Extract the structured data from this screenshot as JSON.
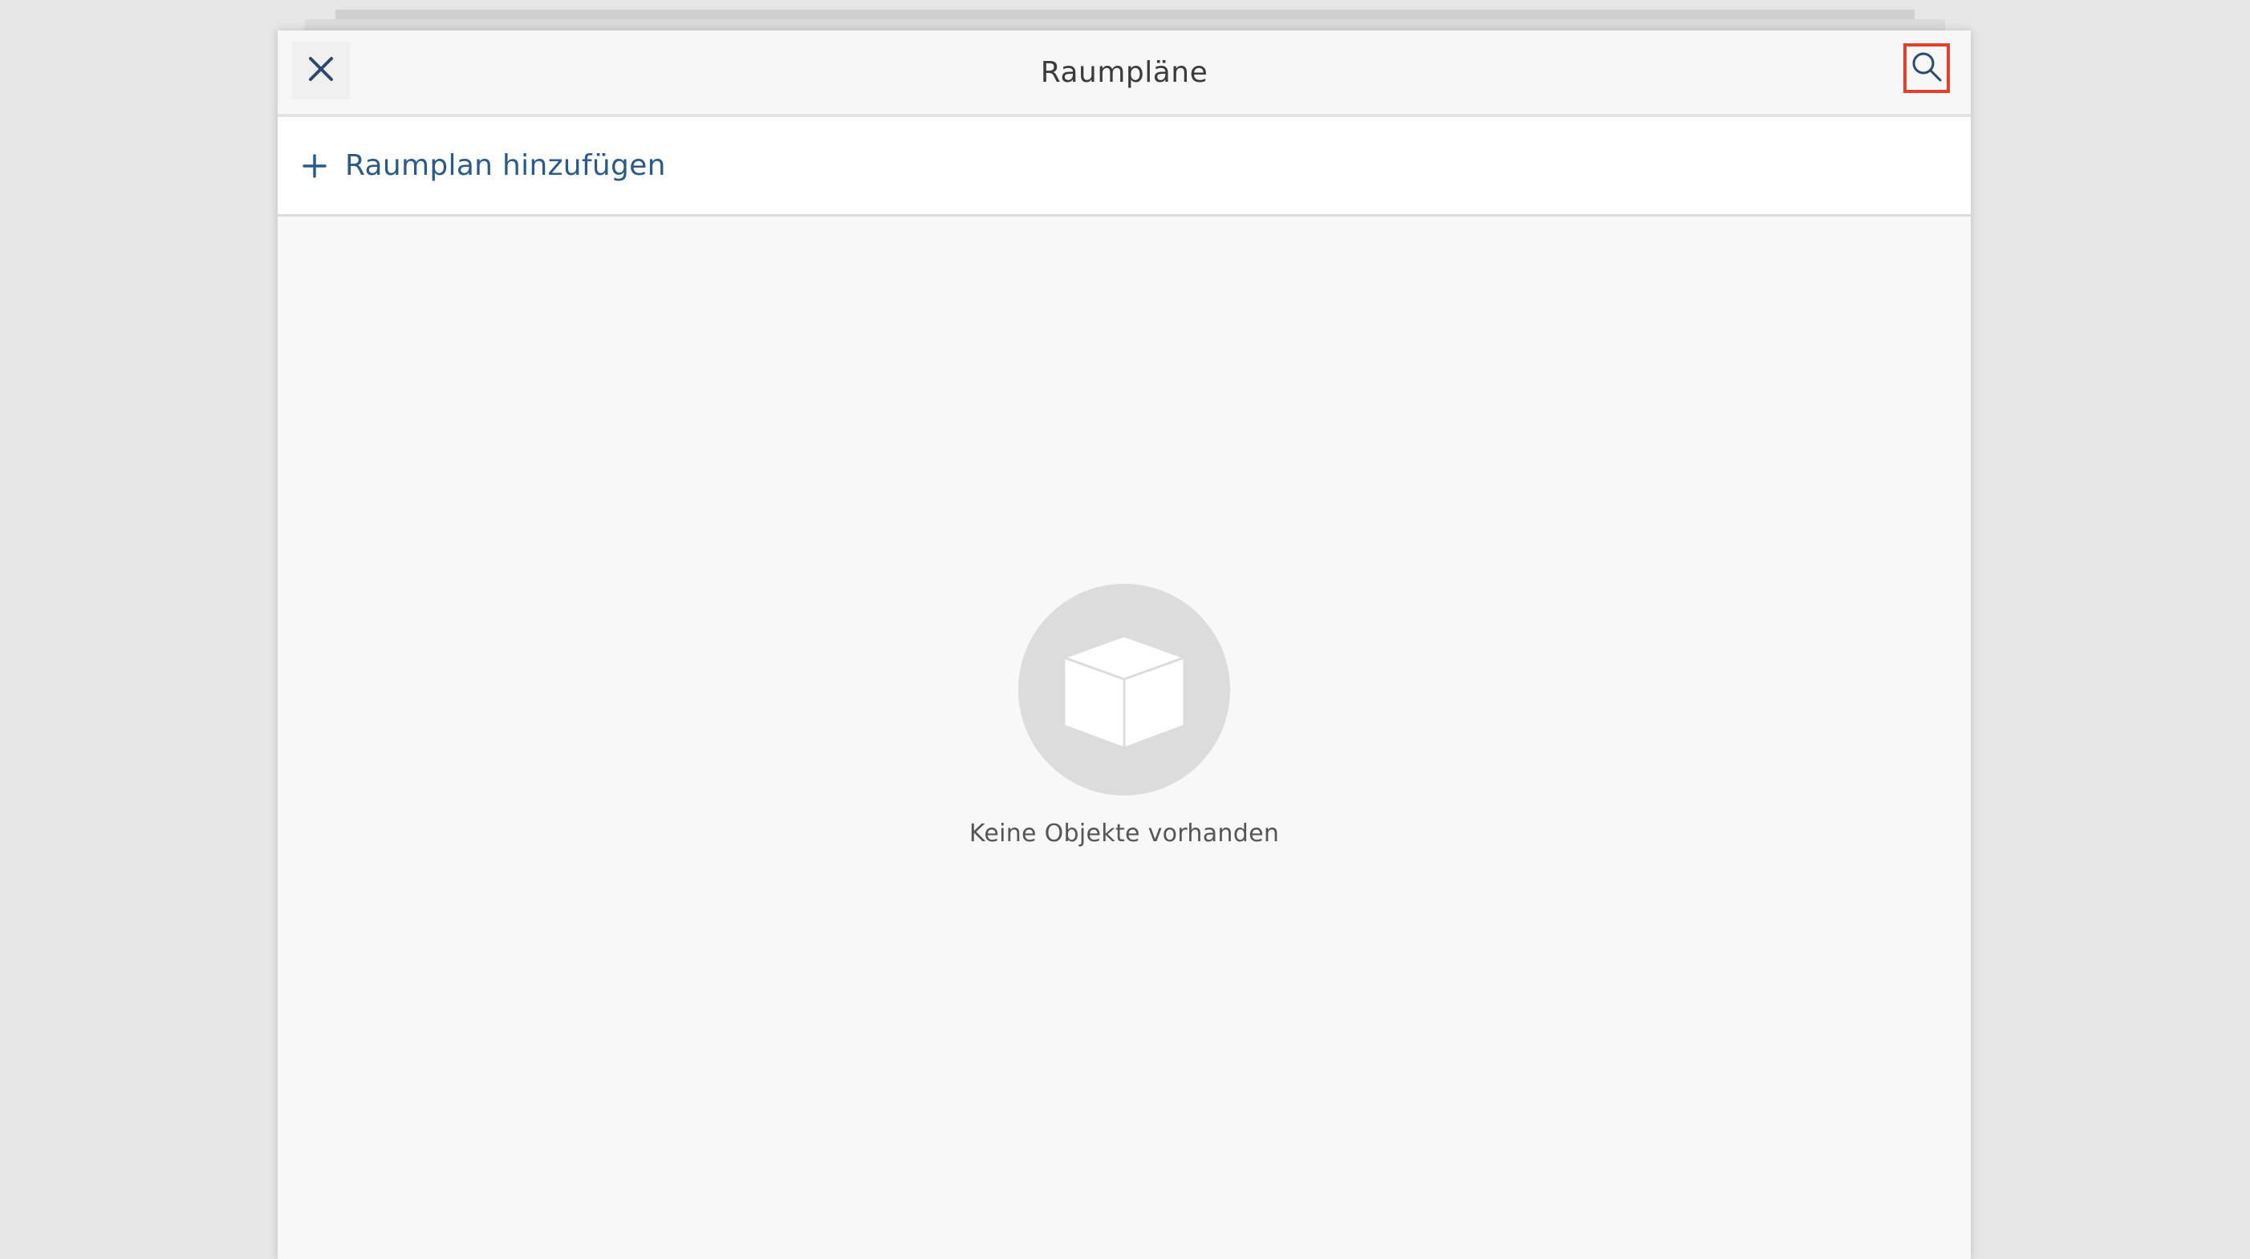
{
  "header": {
    "title": "Raumpläne",
    "close_icon": "close-icon",
    "search_icon": "search-icon"
  },
  "add_row": {
    "icon": "plus-icon",
    "label": "Raumplan hinzufügen"
  },
  "empty_state": {
    "icon": "box-icon",
    "message": "Keine Objekte vorhanden"
  },
  "colors": {
    "accent": "#2a5a8a",
    "highlight": "#e0402c",
    "background": "#e6e6e6",
    "panel": "#f8f8f8"
  }
}
